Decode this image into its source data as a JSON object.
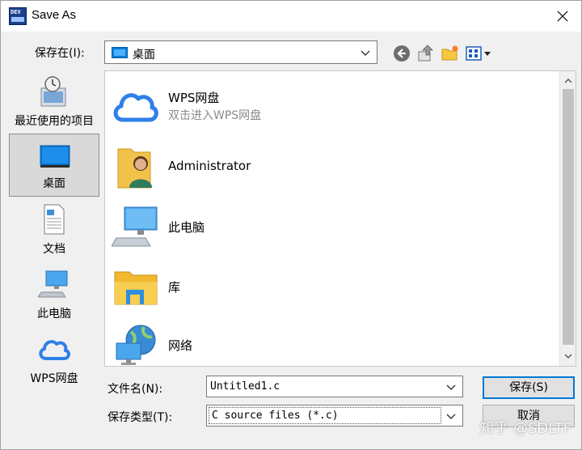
{
  "window": {
    "title": "Save As",
    "icon_text": "DEV"
  },
  "location": {
    "label": "保存在(I):",
    "value": "桌面"
  },
  "places": [
    {
      "label": "最近使用的项目",
      "icon": "recent-icon"
    },
    {
      "label": "桌面",
      "icon": "desktop-icon",
      "selected": true
    },
    {
      "label": "文档",
      "icon": "documents-icon"
    },
    {
      "label": "此电脑",
      "icon": "computer-icon"
    },
    {
      "label": "WPS网盘",
      "icon": "cloud-icon"
    }
  ],
  "files": [
    {
      "name": "WPS网盘",
      "sub": "双击进入WPS网盘",
      "icon": "cloud-icon"
    },
    {
      "name": "Administrator",
      "icon": "user-folder-icon"
    },
    {
      "name": "此电脑",
      "icon": "computer-icon"
    },
    {
      "name": "库",
      "icon": "library-folder-icon"
    },
    {
      "name": "网络",
      "icon": "network-icon"
    }
  ],
  "form": {
    "filename_label": "文件名(N):",
    "filename_value": "Untitled1.c",
    "filetype_label": "保存类型(T):",
    "filetype_value": "C source files (*.c)"
  },
  "buttons": {
    "save": "保存(S)",
    "cancel": "取消"
  },
  "watermark": "知乎 @SDLTF",
  "colors": {
    "accent": "#0078d7",
    "cloud": "#2f80e8",
    "selected_place": "#d9d9d9"
  }
}
